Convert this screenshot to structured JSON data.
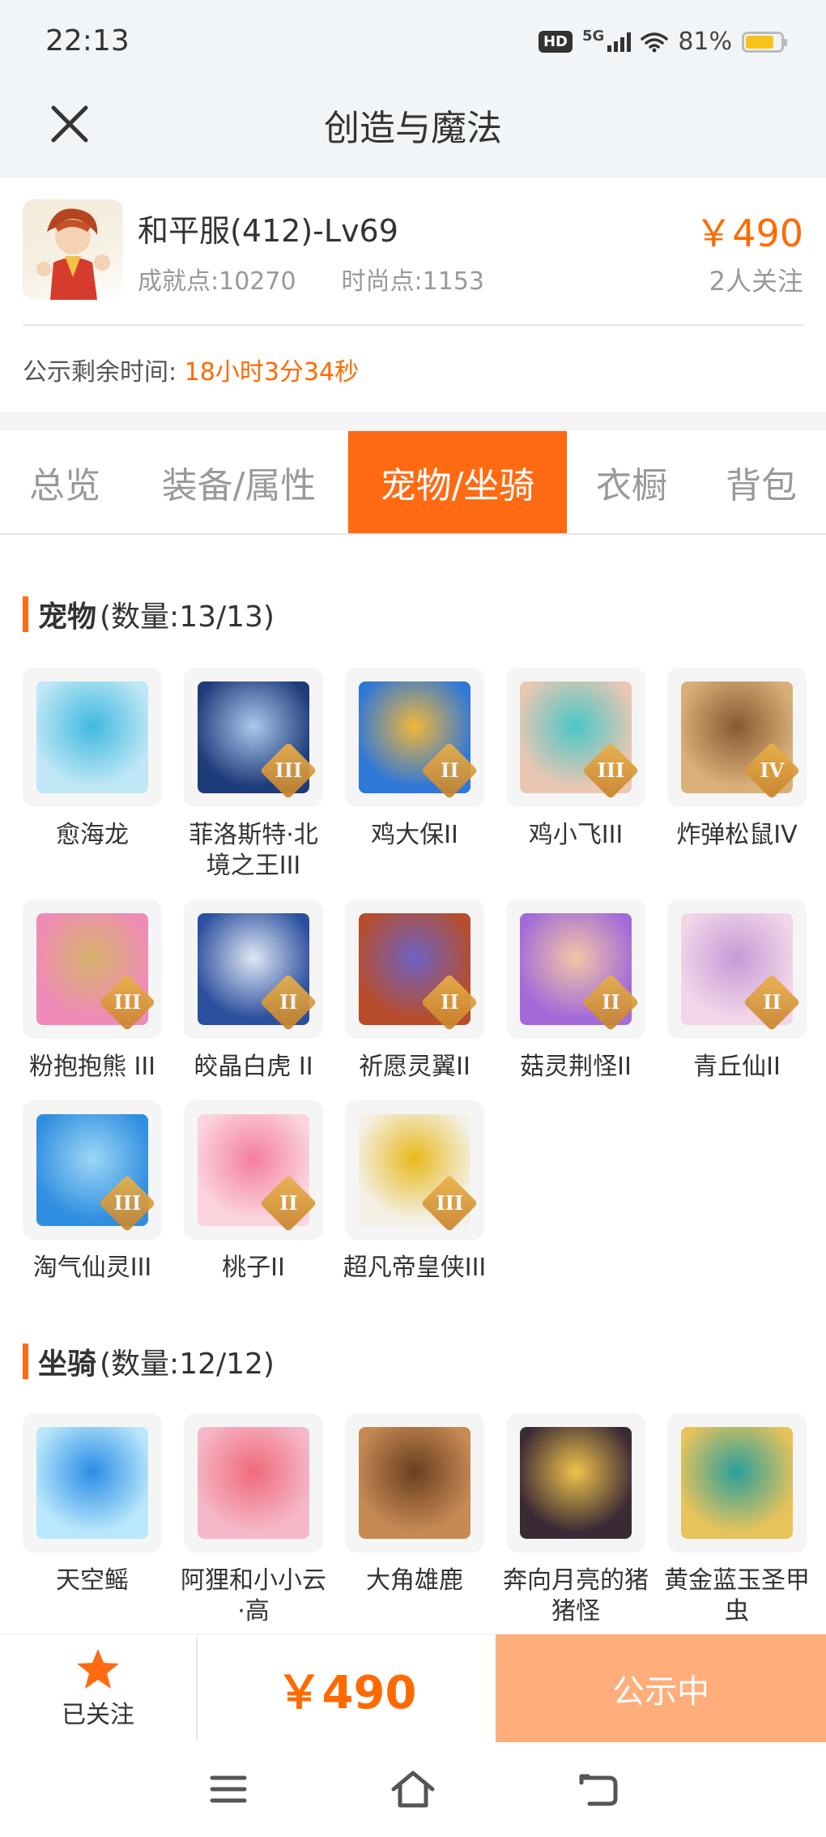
{
  "status_bar": {
    "time": "22:13",
    "hd": "HD",
    "net": "5G",
    "battery": "81%",
    "battery_level": 0.81
  },
  "nav": {
    "title": "创造与魔法"
  },
  "account": {
    "name": "和平服(412)-Lv69",
    "achievement": "成就点:10270",
    "fashion": "时尚点:1153",
    "price": "￥490",
    "watchers": "2人关注"
  },
  "countdown": {
    "label": "公示剩余时间:",
    "value": "18小时3分34秒"
  },
  "tabs": [
    {
      "label": "总览",
      "active": false
    },
    {
      "label": "装备/属性",
      "active": false
    },
    {
      "label": "宠物/坐骑",
      "active": true
    },
    {
      "label": "衣橱",
      "active": false
    },
    {
      "label": "背包",
      "active": false
    }
  ],
  "pets": {
    "title": "宠物",
    "count": "(数量:13/13)",
    "items": [
      {
        "name": "愈海龙",
        "rank": "",
        "colors": [
          "#bfe7f5",
          "#3fb9e0"
        ]
      },
      {
        "name": "菲洛斯特·北境之王III",
        "rank": "III",
        "colors": [
          "#1e3b7a",
          "#a9c9ec"
        ]
      },
      {
        "name": "鸡大保II",
        "rank": "II",
        "colors": [
          "#2f78d8",
          "#f0b73a"
        ]
      },
      {
        "name": "鸡小飞III",
        "rank": "III",
        "colors": [
          "#e9c7b3",
          "#49c7c7"
        ]
      },
      {
        "name": "炸弹松鼠IV",
        "rank": "IV",
        "colors": [
          "#d9b07a",
          "#8a5a30"
        ]
      },
      {
        "name": "粉抱抱熊 III",
        "rank": "III",
        "colors": [
          "#f08ab9",
          "#d6b36a"
        ]
      },
      {
        "name": "皎晶白虎 II",
        "rank": "II",
        "colors": [
          "#2c4f9e",
          "#dfe8f4"
        ]
      },
      {
        "name": "祈愿灵翼II",
        "rank": "II",
        "colors": [
          "#b74d2b",
          "#6d63c5"
        ]
      },
      {
        "name": "菇灵荆怪II",
        "rank": "II",
        "colors": [
          "#a36ad8",
          "#f1c7a6"
        ]
      },
      {
        "name": "青丘仙II",
        "rank": "II",
        "colors": [
          "#f2d6e8",
          "#c69bd8"
        ]
      },
      {
        "name": "淘气仙灵III",
        "rank": "III",
        "colors": [
          "#2f8fe0",
          "#9ed6f6"
        ]
      },
      {
        "name": "桃子II",
        "rank": "II",
        "colors": [
          "#fbd4de",
          "#f47ea2"
        ]
      },
      {
        "name": "超凡帝皇侠III",
        "rank": "III",
        "colors": [
          "#f4f0e6",
          "#e8b91c"
        ]
      }
    ]
  },
  "mounts": {
    "title": "坐骑",
    "count": "(数量:12/12)",
    "items": [
      {
        "name": "天空鳐",
        "rank": "",
        "colors": [
          "#b9e7fb",
          "#2a8ee6"
        ]
      },
      {
        "name": "阿狸和小小云·高",
        "rank": "",
        "colors": [
          "#f5b8c8",
          "#f06a7a"
        ]
      },
      {
        "name": "大角雄鹿",
        "rank": "",
        "colors": [
          "#c78a55",
          "#6a3f1f"
        ]
      },
      {
        "name": "奔向月亮的猪猪怪",
        "rank": "",
        "colors": [
          "#3a2a35",
          "#f0c24a"
        ]
      },
      {
        "name": "黄金蓝玉圣甲虫",
        "rank": "",
        "colors": [
          "#e6c35c",
          "#2a9f9a"
        ]
      }
    ]
  },
  "bottom_bar": {
    "follow_label": "已关注",
    "price": "￥490",
    "status_button": "公示中"
  },
  "icons": {
    "close": "close-icon",
    "star": "star-icon",
    "menu": "menu-icon",
    "home": "home-icon",
    "back": "back-icon"
  },
  "colors": {
    "accent": "#ff6a13",
    "price": "#ff6a00",
    "status_button": "#ffad7a"
  }
}
